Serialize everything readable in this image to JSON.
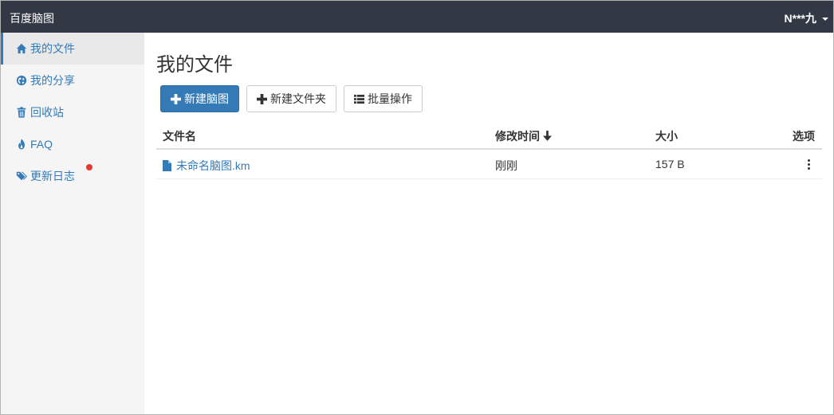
{
  "app": {
    "brand": "百度脑图",
    "user": "N***九"
  },
  "sidebar": {
    "items": [
      {
        "label": "我的文件",
        "icon": "home-icon",
        "active": true
      },
      {
        "label": "我的分享",
        "icon": "globe-icon",
        "active": false
      },
      {
        "label": "回收站",
        "icon": "trash-icon",
        "active": false
      },
      {
        "label": "FAQ",
        "icon": "fire-icon",
        "active": false
      },
      {
        "label": "更新日志",
        "icon": "tags-icon",
        "active": false,
        "badge": "red-dot"
      }
    ]
  },
  "main": {
    "title": "我的文件",
    "toolbar": {
      "new_mindmap": "新建脑图",
      "new_folder": "新建文件夹",
      "batch": "批量操作"
    },
    "table": {
      "headers": {
        "name": "文件名",
        "modified": "修改时间",
        "size": "大小",
        "options": "选项"
      },
      "sort": "modified-desc",
      "rows": [
        {
          "name": "未命名脑图.km",
          "modified": "刚刚",
          "size": "157 B"
        }
      ]
    }
  },
  "colors": {
    "topbar": "#333845",
    "accent": "#337ab7",
    "sidebar_bg": "#f5f5f5",
    "badge": "#e53935"
  }
}
